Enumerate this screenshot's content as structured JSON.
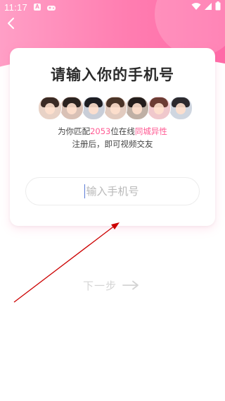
{
  "status_bar": {
    "time": "11:17",
    "notif_a": "A"
  },
  "page": {
    "title": "请输入你的手机号",
    "match_prefix": "为你匹配",
    "match_count": "2053",
    "match_mid": "位在线",
    "match_highlight": "同城异性",
    "sub_text": "注册后，即可视频交友",
    "phone_placeholder": "输入手机号",
    "phone_value": "",
    "next_label": "下一步"
  },
  "icons": {
    "back": "back-arrow-icon",
    "wifi": "wifi-icon",
    "signal": "signal-icon",
    "battery": "battery-icon",
    "next_arrow": "arrow-right-icon"
  },
  "avatars": [
    {
      "hair": "#3a2a24",
      "bg": "#e8d2c6"
    },
    {
      "hair": "#2b2320",
      "bg": "#d9c1b6"
    },
    {
      "hair": "#1d1d22",
      "bg": "#c9ced8"
    },
    {
      "hair": "#4a3428",
      "bg": "#e2cbbf"
    },
    {
      "hair": "#231d1c",
      "bg": "#bfb0a5"
    },
    {
      "hair": "#6b3c34",
      "bg": "#f0c8cc"
    },
    {
      "hair": "#2c2a2e",
      "bg": "#cfd6e0"
    }
  ],
  "colors": {
    "accent": "#ff5a93",
    "header_start": "#ff9fc6",
    "header_end": "#ff6aa7",
    "disabled_text": "#d4d4d4",
    "annotation_arrow": "#cc0000"
  }
}
